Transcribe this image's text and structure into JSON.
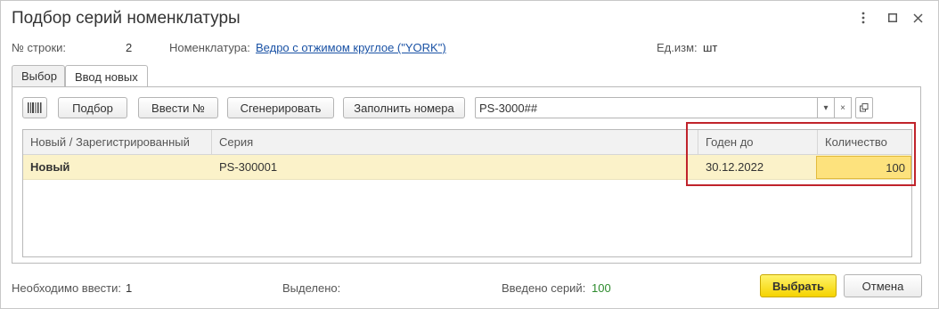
{
  "window": {
    "title": "Подбор серий номенклатуры",
    "menu_icon": "more-vertical-icon",
    "maximize_icon": "maximize-icon",
    "close_icon": "close-icon"
  },
  "info": {
    "row_label": "№ строки:",
    "row_value": "2",
    "item_label": "Номенклатура:",
    "item_value": "Ведро с отжимом  круглое (\"YORK\")",
    "unit_label": "Ед.изм:",
    "unit_value": "шт"
  },
  "tabs": [
    {
      "label": "Выбор",
      "active": false
    },
    {
      "label": "Ввод новых",
      "active": true
    }
  ],
  "toolbar": {
    "barcode_icon": "barcode-icon",
    "select_label": "Подбор",
    "enter_label": "Ввести №",
    "generate_label": "Сгенерировать",
    "fill_label": "Заполнить номера",
    "template_value": "PS-3000##",
    "dropdown_icon": "dropdown-arrow-icon",
    "clear_icon": "clear-icon",
    "open_icon": "open-icon"
  },
  "table": {
    "columns": [
      "Новый / Зарегистрированный",
      "Серия",
      "Годен до",
      "Количество"
    ],
    "rows": [
      {
        "status": "Новый",
        "series": "PS-300001",
        "expiry": "30.12.2022",
        "quantity": "100"
      }
    ]
  },
  "footer": {
    "need_label": "Необходимо ввести:",
    "need_value": "1",
    "selected_label": "Выделено:",
    "entered_label": "Введено серий:",
    "entered_value": "100",
    "ok_label": "Выбрать",
    "cancel_label": "Отмена"
  },
  "colors": {
    "accent_yellow": "#f5d300",
    "row_highlight": "#fbf2c9",
    "link": "#1a52a5",
    "highlight_box": "#c0232b",
    "entered_value": "#2e8b2e"
  }
}
